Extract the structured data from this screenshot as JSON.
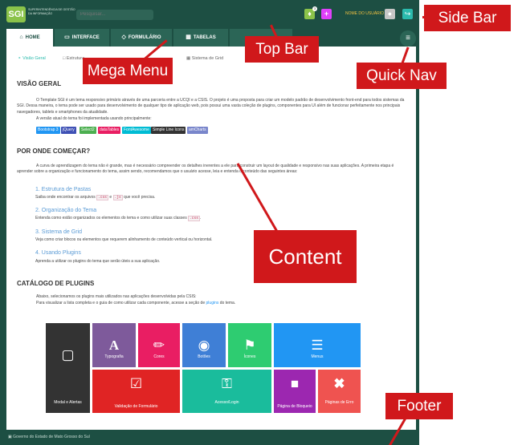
{
  "topbar": {
    "logo_text": "Superintendência de Gestão da Informação",
    "logo_mark": "SGI",
    "search_placeholder": "Pesquisar...",
    "notification_count": "3",
    "user_name": "NOME DO USUÁRIO"
  },
  "nav": {
    "tabs": [
      {
        "label": "Home",
        "icon": "home-icon"
      },
      {
        "label": "Interface",
        "icon": "monitor-icon"
      },
      {
        "label": "Formulário",
        "icon": "layers-icon"
      },
      {
        "label": "Tabelas",
        "icon": "table-icon"
      }
    ]
  },
  "subnav": {
    "items": [
      "Visão Geral",
      "Estrutura",
      "Sistema de Grid"
    ]
  },
  "content": {
    "visao_geral_title": "Visão Geral",
    "visao_geral_p1": "O Template SGI é um tema responsivo primário através de uma parceria entre a UCQI e a CSIS. O projeto é uma proposta para criar um modelo padrão de desenvolvimento front-end para todos sistemas da SGI. Dessa maneira, o tema pode ser usado para desenvolvimento de qualquer tipo de aplicação web, pois possui uma vasta coleção de plugins, componentes para UI além de funcionar perfeitamente nos principais navegadores, tablets e smartphones da atualidade.",
    "visao_geral_p2": "A versão atual do tema foi implementada usando principalmente:",
    "badges": [
      {
        "label": "Bootstrap 3",
        "color": "#2196f3"
      },
      {
        "label": "jQuery",
        "color": "#3f51b5"
      },
      {
        "label": "Select2",
        "color": "#4caf50"
      },
      {
        "label": "dataTables",
        "color": "#e91e63"
      },
      {
        "label": "FontAwesome",
        "color": "#00bcd4"
      },
      {
        "label": "Simple Line Icons",
        "color": "#333333"
      },
      {
        "label": "amCharts",
        "color": "#7986cb"
      }
    ],
    "onde_title": "Por onde começar?",
    "onde_p": "A curva de aprendizagem do tema não é grande, mas é necessário compreender os detalhes inerentes a ele para construir um layout de qualidade e responsivo nas suas aplicações. A primeira etapa é aprender sobre a organização e funcionamento do tema, assim sendo, recomendamos que o usuário acesse, leia e entenda o conteúdo das seguintes áreas:",
    "steps": [
      {
        "title": "1. Estrutura de Pastas",
        "desc_before": "Saiba onde encontrar os arquivos ",
        "code1": ".css",
        "desc_mid": " e ",
        "code2": ".js",
        "desc_after": " que você precisa."
      },
      {
        "title": "2. Organização do Tema",
        "desc_before": "Entenda como estão organizados os elementos do tema e como utilizar suas classes ",
        "code1": ".css",
        "desc_mid": "",
        "code2": "",
        "desc_after": "."
      },
      {
        "title": "3. Sistema de Grid",
        "desc_before": "Veja como criar blocos ou elementos que requerem alinhamento de conteúdo vertical ou horizontal.",
        "code1": "",
        "desc_mid": "",
        "code2": "",
        "desc_after": ""
      },
      {
        "title": "4. Usando Plugins",
        "desc_before": "Aprenda a utilizar os plugins do tema que serão úteis a sua aplicação.",
        "code1": "",
        "desc_mid": "",
        "code2": "",
        "desc_after": ""
      }
    ],
    "catalogo_title": "Catálogo de Plugins",
    "catalogo_p1": "Abaixo, selecionamos os plugins mais utilizados nas aplicações desenvolvidas pela CSIS:",
    "catalogo_p2_before": "Para visualizar a lista completa e o guia de como utilizar cada componente, acesse a seção de ",
    "catalogo_p2_link": "plugins",
    "catalogo_p2_after": " do tema."
  },
  "tiles": [
    {
      "label": "Modal e Alertas",
      "icon": "window-icon",
      "color": "#333333"
    },
    {
      "label": "Typografia",
      "icon": "type-icon",
      "color": "#7e5a9b"
    },
    {
      "label": "Cores",
      "icon": "brush-icon",
      "color": "#e91e63"
    },
    {
      "label": "Botões",
      "icon": "toggle-icon",
      "color": "#3f7fd6"
    },
    {
      "label": "Ícones",
      "icon": "flag-icon",
      "color": "#2ecc71"
    },
    {
      "label": "Menus",
      "icon": "menu-icon",
      "color": "#2196f3"
    },
    {
      "label": "Validação de Formulário",
      "icon": "checkbox-icon",
      "color": "#e02424"
    },
    {
      "label": "Acesso/Login",
      "icon": "key-icon",
      "color": "#1abc9c"
    },
    {
      "label": "Página de Bloqueio",
      "icon": "lock-icon",
      "color": "#9c27b0"
    },
    {
      "label": "Páginas de Erro",
      "icon": "x-icon",
      "color": "#ef5350"
    }
  ],
  "footer": {
    "text": "Governo do Estado de Mato Grosso do Sul"
  },
  "callouts": {
    "side_bar": "Side Bar",
    "top_bar": "Top Bar",
    "mega_menu": "Mega Menu",
    "quick_nav": "Quick Nav",
    "content": "Content",
    "footer": "Footer"
  }
}
